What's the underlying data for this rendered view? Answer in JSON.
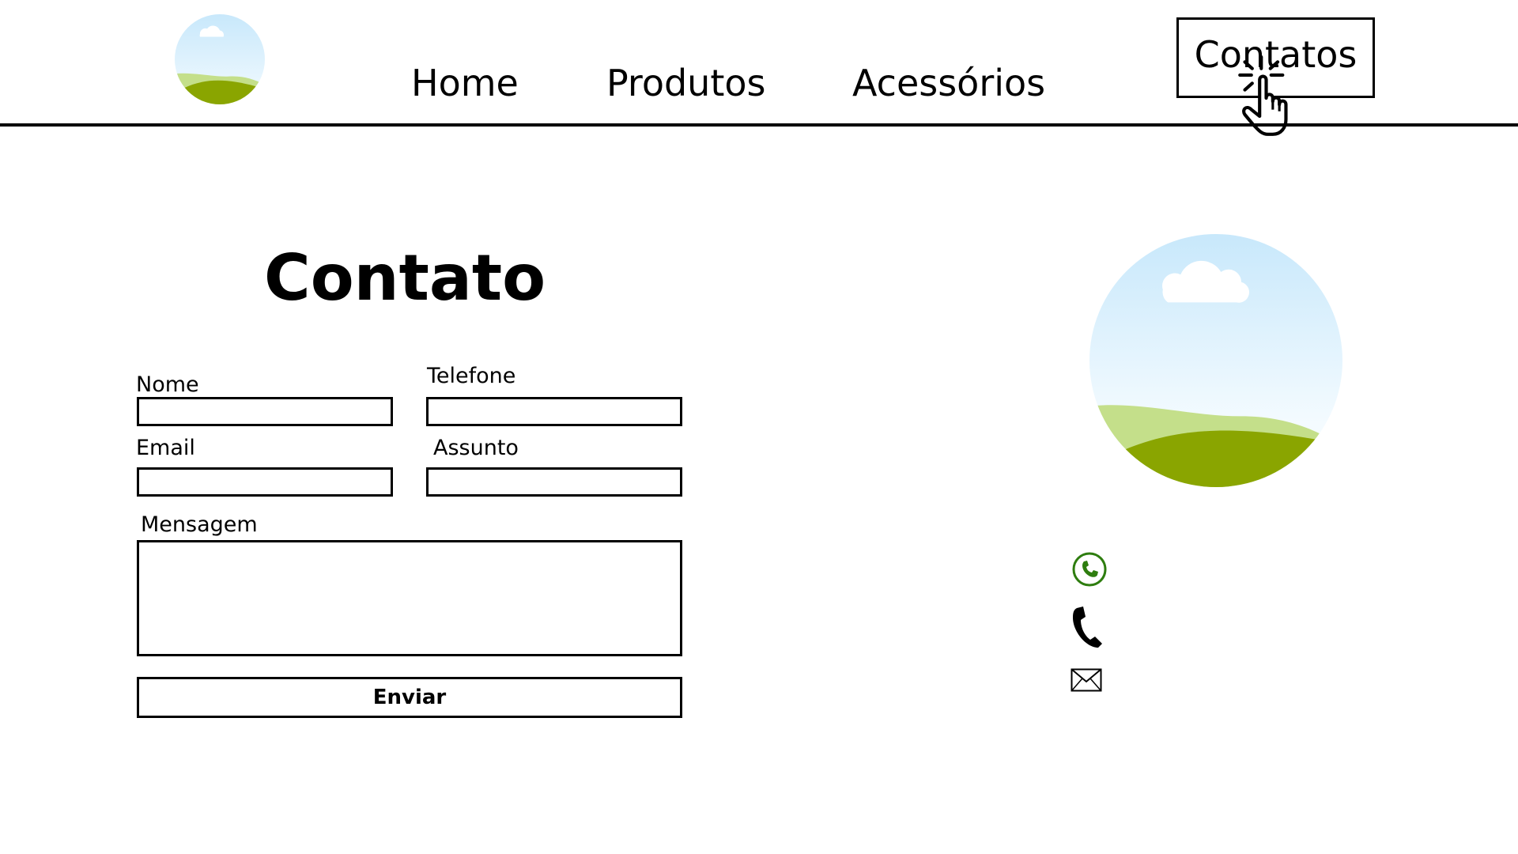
{
  "header": {
    "nav": {
      "home": "Home",
      "produtos": "Produtos",
      "acessorios": "Acessórios",
      "contatos": "Contatos"
    }
  },
  "form": {
    "title": "Contato",
    "fields": {
      "nome": {
        "label": "Nome",
        "value": ""
      },
      "telefone": {
        "label": "Telefone",
        "value": ""
      },
      "email": {
        "label": "Email",
        "value": ""
      },
      "assunto": {
        "label": "Assunto",
        "value": ""
      },
      "mensagem": {
        "label": "Mensagem",
        "value": ""
      }
    },
    "submit_label": "Enviar"
  },
  "icons": {
    "logo": "landscape-logo-icon",
    "cursor": "pointer-hand-icon",
    "whatsapp": "whatsapp-icon",
    "phone": "phone-icon",
    "mail": "mail-icon"
  },
  "colors": {
    "accent_green": "#2e7d0f",
    "sky_top": "#c8e8fb",
    "hill_dark": "#8aa500",
    "hill_light": "#c4df8a"
  }
}
